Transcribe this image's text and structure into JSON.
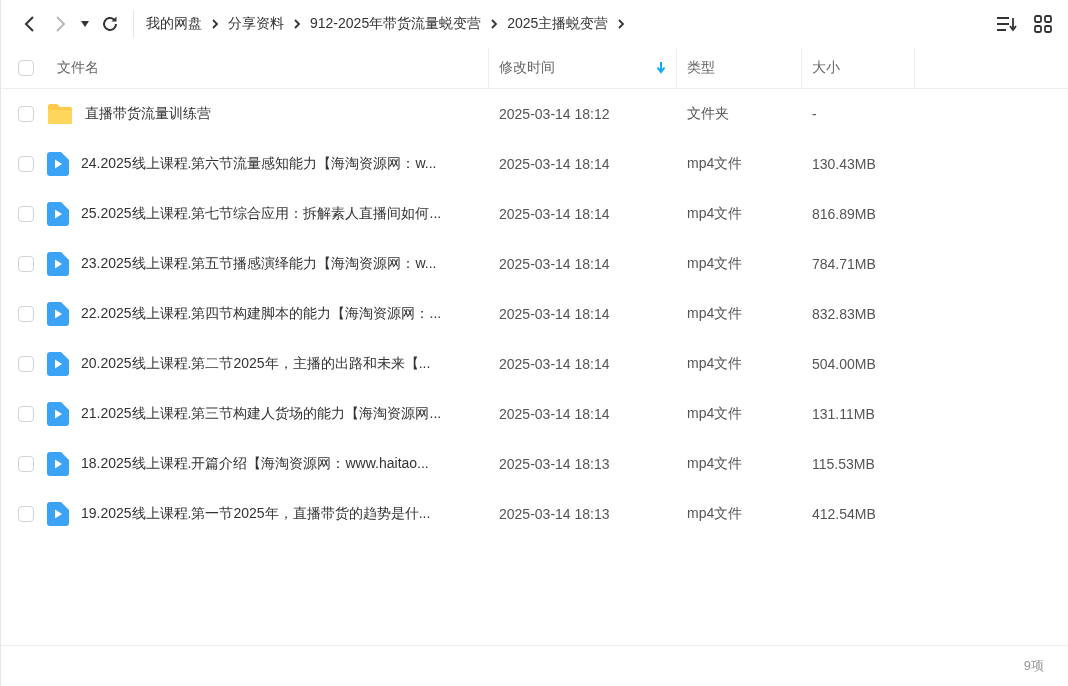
{
  "nav": {
    "back_disabled": false,
    "forward_disabled": true
  },
  "breadcrumb": [
    "我的网盘",
    "分享资料",
    "912-2025年带货流量蜕变营",
    "2025主播蜕变营"
  ],
  "table": {
    "select_all_checked": false,
    "columns": [
      {
        "label": "文件名",
        "sorted": false
      },
      {
        "label": "修改时间",
        "sorted": true
      },
      {
        "label": "类型",
        "sorted": false
      },
      {
        "label": "大小",
        "sorted": false
      }
    ],
    "rows": [
      {
        "kind": "folder",
        "checked": false,
        "name": "直播带货流量训练营",
        "modified": "2025-03-14 18:12",
        "type": "文件夹",
        "size": "-"
      },
      {
        "kind": "video",
        "checked": false,
        "name": "24.2025线上课程.第六节流量感知能力【海淘资源网：w...",
        "modified": "2025-03-14 18:14",
        "type": "mp4文件",
        "size": "130.43MB"
      },
      {
        "kind": "video",
        "checked": false,
        "name": "25.2025线上课程.第七节综合应用：拆解素人直播间如何...",
        "modified": "2025-03-14 18:14",
        "type": "mp4文件",
        "size": "816.89MB"
      },
      {
        "kind": "video",
        "checked": false,
        "name": "23.2025线上课程.第五节播感演绎能力【海淘资源网：w...",
        "modified": "2025-03-14 18:14",
        "type": "mp4文件",
        "size": "784.71MB"
      },
      {
        "kind": "video",
        "checked": false,
        "name": "22.2025线上课程.第四节构建脚本的能力【海淘资源网：...",
        "modified": "2025-03-14 18:14",
        "type": "mp4文件",
        "size": "832.83MB"
      },
      {
        "kind": "video",
        "checked": false,
        "name": "20.2025线上课程.第二节2025年，主播的出路和未来【...",
        "modified": "2025-03-14 18:14",
        "type": "mp4文件",
        "size": "504.00MB"
      },
      {
        "kind": "video",
        "checked": false,
        "name": "21.2025线上课程.第三节构建人货场的能力【海淘资源网...",
        "modified": "2025-03-14 18:14",
        "type": "mp4文件",
        "size": "131.11MB"
      },
      {
        "kind": "video",
        "checked": false,
        "name": "18.2025线上课程.开篇介绍【海淘资源网：www.haitao...",
        "modified": "2025-03-14 18:13",
        "type": "mp4文件",
        "size": "115.53MB"
      },
      {
        "kind": "video",
        "checked": false,
        "name": "19.2025线上课程.第一节2025年，直播带货的趋势是什...",
        "modified": "2025-03-14 18:13",
        "type": "mp4文件",
        "size": "412.54MB"
      }
    ]
  },
  "status_bar": {
    "count": "9项"
  }
}
